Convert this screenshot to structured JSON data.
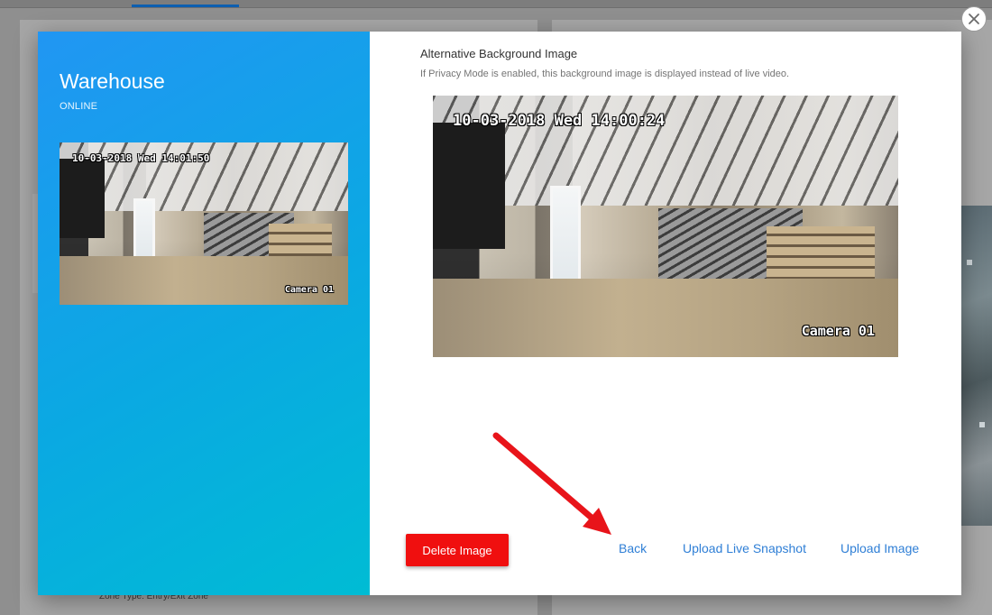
{
  "device": {
    "name": "Warehouse",
    "status": "ONLINE"
  },
  "thumbnail": {
    "timestamp": "10-03-2018 Wed 14:01:50",
    "camera_label": "Camera 01"
  },
  "alt_background": {
    "title": "Alternative Background Image",
    "description": "If Privacy Mode is enabled, this background image is displayed instead of live video.",
    "timestamp": "10-03-2018 Wed 14:00:24",
    "camera_label": "Camera 01"
  },
  "actions": {
    "delete_label": "Delete Image",
    "back_label": "Back",
    "snapshot_label": "Upload Live Snapshot",
    "upload_label": "Upload Image"
  },
  "background_page": {
    "zone_type_text": "Zone Type: Entry/Exit Zone"
  },
  "colors": {
    "panel_gradient_start": "#2196f3",
    "panel_gradient_end": "#00bcd4",
    "delete_button": "#f00f0f",
    "link": "#2f7fd6",
    "annotation_arrow": "#e8141a"
  },
  "icons": {
    "close": "close-icon",
    "annotation": "red-arrow-annotation"
  }
}
